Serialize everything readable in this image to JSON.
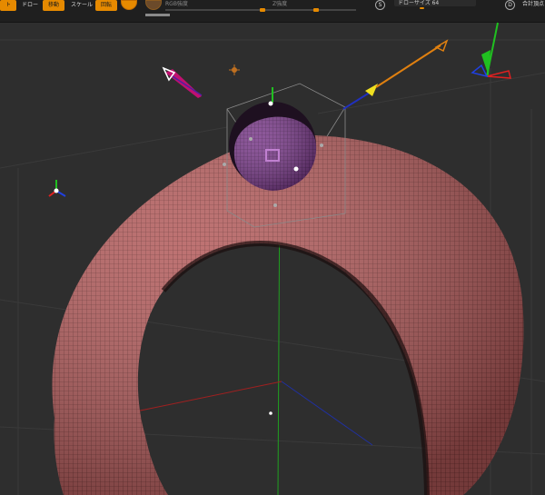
{
  "toolbar": {
    "edge_label": "ト",
    "item1": "ドロー",
    "move_label": "移動",
    "scale_label": "スケール",
    "rotate_label": "回転",
    "rgb_label": "RGB強度",
    "z_label": "Z強度",
    "draw_size": "ドローサイズ 64",
    "s_label": "S",
    "d_label": "D",
    "points_label": "合計頂点"
  },
  "colors": {
    "accent": "#e68a00",
    "torus": "#b25a5a",
    "sphere": "#7a3a8a",
    "axis_x": "#e02020",
    "axis_y": "#20c020",
    "axis_z": "#2040e0"
  }
}
